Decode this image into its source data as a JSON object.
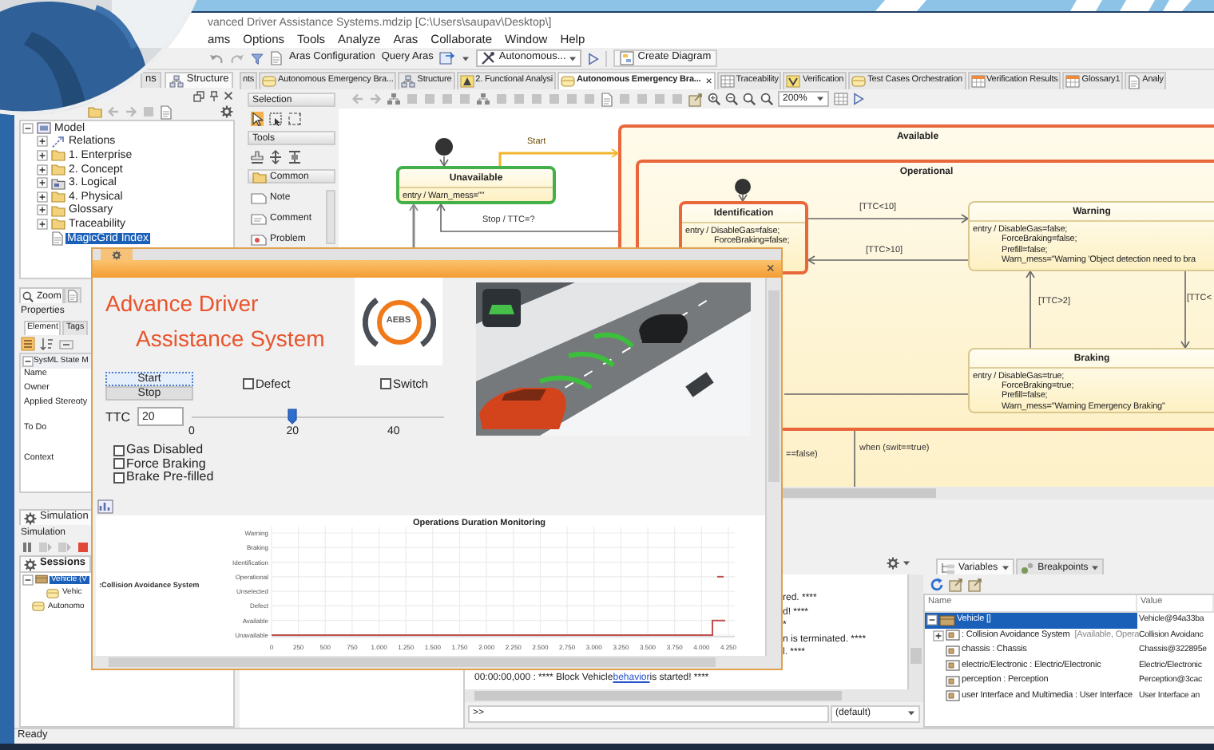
{
  "window": {
    "title": "vanced Driver Assistance Systems.mdzip [C:\\Users\\saupav\\Desktop\\]"
  },
  "menu": [
    "ams",
    "Options",
    "Tools",
    "Analyze",
    "Aras",
    "Collaborate",
    "Window",
    "Help"
  ],
  "toolbar": {
    "buttons": [
      "Aras Configuration",
      "Query Aras"
    ],
    "diagram_combo": "Autonomous...",
    "create_button": "Create Diagram"
  },
  "browser": {
    "tabs": [
      {
        "label": "ns",
        "kind": "none",
        "selected": false
      },
      {
        "label": "Structure",
        "kind": "structure",
        "selected": true
      }
    ],
    "tree": [
      {
        "label": "Model",
        "kind": "model",
        "expanded": true,
        "selected": false,
        "children": [
          {
            "label": "Relations",
            "kind": "relations",
            "expanded": false,
            "selected": false
          },
          {
            "label": "1. Enterprise",
            "kind": "folder",
            "expanded": false,
            "selected": false
          },
          {
            "label": "2. Concept",
            "kind": "folder",
            "expanded": false,
            "selected": false
          },
          {
            "label": "3. Logical",
            "kind": "package",
            "expanded": false,
            "selected": false
          },
          {
            "label": "4. Physical",
            "kind": "folder",
            "expanded": false,
            "selected": false
          },
          {
            "label": "Glossary",
            "kind": "folder",
            "expanded": false,
            "selected": false
          },
          {
            "label": "Traceability",
            "kind": "folder",
            "expanded": false,
            "selected": false
          },
          {
            "label": "MagicGrid Index",
            "kind": "document",
            "selected": true
          }
        ]
      }
    ]
  },
  "properties": {
    "tab": "Zoom",
    "title": "Properties",
    "subtabs": [
      {
        "label": "Element",
        "selected": true
      },
      {
        "label": "Tags",
        "selected": false
      }
    ],
    "group": "SysML State M",
    "fields": [
      "Name",
      "Owner",
      "Applied Stereoty",
      "To Do",
      "Context"
    ]
  },
  "simulation": {
    "tab": "Simulation",
    "title": "Simulation",
    "sessions_tab": "Sessions",
    "sessions": [
      {
        "label": "Vehicle (V",
        "kind": "block",
        "expanded": true,
        "selected": true,
        "children": [
          {
            "label": "Vehic",
            "kind": "diagram",
            "selected": false
          }
        ]
      },
      {
        "label": "Autonomo",
        "kind": "diagram",
        "selected": false
      }
    ]
  },
  "diagram_tabs": [
    {
      "label": "nts",
      "kind": "none",
      "selected": false
    },
    {
      "label": "Autonomous Emergency Bra...",
      "kind": "state",
      "selected": false
    },
    {
      "label": "Structure",
      "kind": "structure",
      "selected": false
    },
    {
      "label": "2. Functional Analysi",
      "kind": "analysis",
      "selected": false
    },
    {
      "label": "Autonomous Emergency Bra...",
      "kind": "state",
      "selected": true,
      "close": "×"
    },
    {
      "label": "Traceability",
      "kind": "matrix",
      "selected": false
    },
    {
      "label": "Verification",
      "kind": "verification",
      "selected": false
    },
    {
      "label": "Test Cases Orchestration",
      "kind": "state",
      "selected": false
    },
    {
      "label": "Verification Results",
      "kind": "table",
      "selected": false
    },
    {
      "label": "Glossary1",
      "kind": "table",
      "selected": false
    },
    {
      "label": "Analy",
      "kind": "document",
      "selected": false
    }
  ],
  "palette": {
    "sections": [
      {
        "label": "Selection",
        "tools": [
          {
            "kind": "pointer",
            "selected": true
          },
          {
            "kind": "marquee",
            "selected": false
          },
          {
            "kind": "lasso",
            "selected": false
          }
        ]
      },
      {
        "label": "Tools",
        "tools": [
          {
            "kind": "stamp",
            "selected": false
          },
          {
            "kind": "split",
            "selected": false
          },
          {
            "kind": "align",
            "selected": false
          }
        ]
      },
      {
        "label": "Common",
        "items": [
          "Note",
          "Comment",
          "Problem"
        ]
      }
    ]
  },
  "diagram": {
    "zoom": "200%",
    "states": [
      {
        "name": "Available",
        "kind": "composite",
        "active": true,
        "color": "#e8683c"
      },
      {
        "name": "Operational",
        "kind": "composite",
        "active": true,
        "color": "#e8683c"
      },
      {
        "name": "Unavailable",
        "kind": "simple",
        "active": true,
        "color": "#44b04a",
        "behavior": [
          "entry / Warn_mess=\"\""
        ]
      },
      {
        "name": "Identification",
        "kind": "simple",
        "active": true,
        "color": "#e8683c",
        "behavior": [
          "entry / DisableGas=false;",
          "ForceBraking=false;"
        ]
      },
      {
        "name": "Warning",
        "kind": "simple",
        "active": false,
        "color": "#d9c88e",
        "behavior": [
          "entry / DisableGas=false;",
          "ForceBraking=false;",
          "Prefill=false;",
          "Warn_mess=\"Warning 'Object detection need to bra"
        ]
      },
      {
        "name": "Braking",
        "kind": "simple",
        "active": false,
        "color": "#d9c88e",
        "behavior": [
          "entry / DisableGas=true;",
          "ForceBraking=true;",
          "Prefill=false;",
          "Warn_mess=\"Warning Emergency Braking\""
        ]
      }
    ],
    "transitions": [
      {
        "label": "Start",
        "active": true
      },
      {
        "label": "Stop / TTC=?",
        "active": false
      },
      {
        "label": "[TTC<10]",
        "active": false
      },
      {
        "label": "[TTC>10]",
        "active": false
      },
      {
        "label": "[TTC>2]",
        "active": false
      },
      {
        "label": "[TTC<",
        "active": false
      },
      {
        "label": "==false)",
        "active": false
      },
      {
        "label": "when (swit==true)",
        "active": false
      }
    ]
  },
  "simulation_window": {
    "close": "×",
    "heading": [
      "Advance Driver",
      "Assistance System"
    ],
    "logo": "AEBS",
    "buttons": [
      {
        "label": "Start",
        "focused": true
      },
      {
        "label": "Stop",
        "focused": false
      }
    ],
    "switches": [
      {
        "label": "Defect",
        "checked": false
      },
      {
        "label": "Switch",
        "checked": false
      }
    ],
    "ttc": {
      "label": "TTC",
      "value": "20"
    },
    "slider": {
      "level": 0.4,
      "ticks": [
        "0",
        "20",
        "40"
      ]
    },
    "outputs": [
      {
        "label": "Gas Disabled",
        "checked": false
      },
      {
        "label": "Force Braking",
        "checked": false
      },
      {
        "label": "Brake Pre-filled",
        "checked": false
      }
    ],
    "timeline": {
      "title": "Operations Duration Monitoring",
      "group": ":Collision Avoidance System",
      "rows": [
        "Warning",
        "Braking",
        "Identification",
        "Operational",
        "Unselected",
        "Defect",
        "Available",
        "Unavailable"
      ],
      "ticks": [
        "0",
        "250",
        "500",
        "750",
        "1.000",
        "1.250",
        "1.500",
        "1.750",
        "2.000",
        "2.250",
        "2.500",
        "2.750",
        "3.000",
        "3.250",
        "3.500",
        "3.750",
        "4.000",
        "4.250"
      ]
    }
  },
  "console": {
    "lines": [
      "red. ****",
      "d! ****",
      "*",
      "n is terminated. ****",
      "l. ****"
    ],
    "message": {
      "before": "00:00:00,000 : **** Block Vehicle ",
      "link": "behavior",
      "after": " is started! ****"
    },
    "prompt": ">>",
    "scope": "(default)"
  },
  "variables": {
    "tabs": [
      {
        "label": "Variables",
        "selected": true
      },
      {
        "label": "Breakpoints",
        "selected": false
      }
    ],
    "columns": [
      "Name",
      "Value"
    ],
    "rows": [
      {
        "name": "Vehicle []",
        "value": "Vehicle@94a33ba",
        "selected": true,
        "expanded": true,
        "children": [
          {
            "name": ": Collision Avoidance System",
            "status": "[Available, Opera",
            "value": "Collision Avoidanc",
            "selected": false,
            "expanded": false
          },
          {
            "name": "chassis : Chassis",
            "value": "Chassis@322895e",
            "selected": false
          },
          {
            "name": "electric/Electronic : Electric/Electronic",
            "value": "Electric/Electronic",
            "selected": false
          },
          {
            "name": "perception : Perception",
            "value": "Perception@3cac",
            "selected": false
          },
          {
            "name": "user Interface and Multimedia : User Interface",
            "value": "User Interface an",
            "selected": false
          }
        ]
      }
    ]
  },
  "status_bar": "Ready"
}
